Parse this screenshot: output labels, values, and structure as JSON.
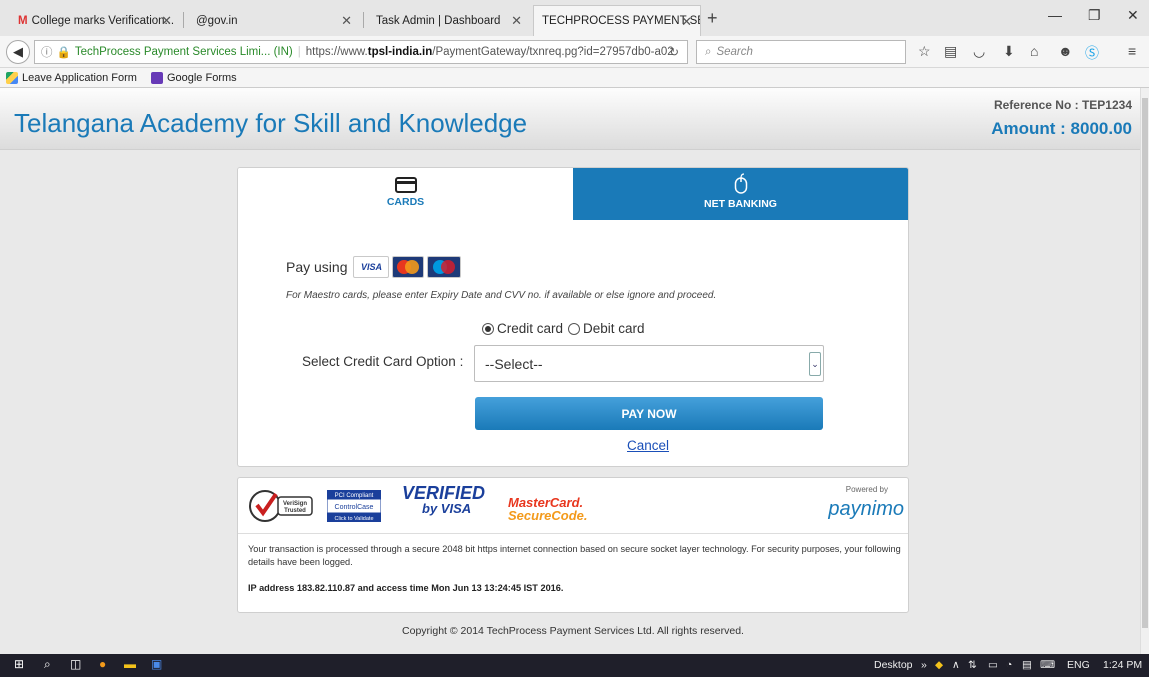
{
  "browser": {
    "tabs": [
      {
        "label": "College marks Verification...",
        "icon": "gmail-icon",
        "active": false
      },
      {
        "label": "@gov.in",
        "icon": "",
        "active": false
      },
      {
        "label": "Task Admin | Dashboard",
        "icon": "",
        "active": false
      },
      {
        "label": "TECHPROCESS PAYMENT SER...",
        "icon": "",
        "active": true
      }
    ],
    "address": {
      "site_identity": "TechProcess Payment Services Limi... (IN)",
      "url_prefix": "https://www.",
      "url_domain": "tpsl-india.in",
      "url_path": "/PaymentGateway/txnreq.pg?id=27957db0-a02"
    },
    "search_placeholder": "Search",
    "bookmarks": [
      {
        "label": "Leave Application Form",
        "icon": "google-drive-icon"
      },
      {
        "label": "Google Forms",
        "icon": "google-forms-icon"
      }
    ]
  },
  "header": {
    "title": "Telangana Academy for Skill and Knowledge",
    "reference": "Reference No : TEP1234",
    "amount": "Amount : 8000.00"
  },
  "payment": {
    "tabs": [
      {
        "label": "CARDS",
        "icon": "card-icon",
        "active": true
      },
      {
        "label": "NET BANKING",
        "icon": "mouse-icon",
        "active": false
      }
    ],
    "pay_using": "Pay using",
    "card_logos": [
      "VISA",
      "MasterCard",
      "Maestro"
    ],
    "maestro_note": "For Maestro cards, please enter Expiry Date and CVV no. if available or else ignore and proceed.",
    "card_type_options": [
      {
        "label": "Credit card",
        "selected": true
      },
      {
        "label": "Debit card",
        "selected": false
      }
    ],
    "select_label": "Select Credit Card Option :",
    "select_value": "--Select--",
    "pay_button": "PAY NOW",
    "cancel_link": "Cancel"
  },
  "security": {
    "seal_verisign": [
      "VeriSign",
      "Trusted"
    ],
    "seal_controlcase": [
      "PCI Compliant",
      "ControlCase",
      "Click to Validate"
    ],
    "verified_by_visa": [
      "VERIFIED",
      "by VISA"
    ],
    "mastercard_securecode": [
      "MasterCard.",
      "SecureCode."
    ],
    "powered_by": "Powered by",
    "paynimo": "paynimo",
    "notice": "Your transaction is processed through a secure 2048 bit https internet connection based on secure socket layer technology. For security purposes, your following details have been logged.",
    "ip_line": "IP address 183.82.110.87 and access time Mon Jun 13 13:24:45 IST 2016."
  },
  "footer": {
    "copyright": "Copyright © 2014 TechProcess Payment Services Ltd. All rights reserved."
  },
  "taskbar": {
    "desktop_label": "Desktop",
    "language": "ENG",
    "time": "1:24 PM"
  },
  "colors": {
    "brand_blue": "#1a7ab8",
    "link_blue": "#1a4fb8",
    "mastercard_red": "#e8371f"
  }
}
